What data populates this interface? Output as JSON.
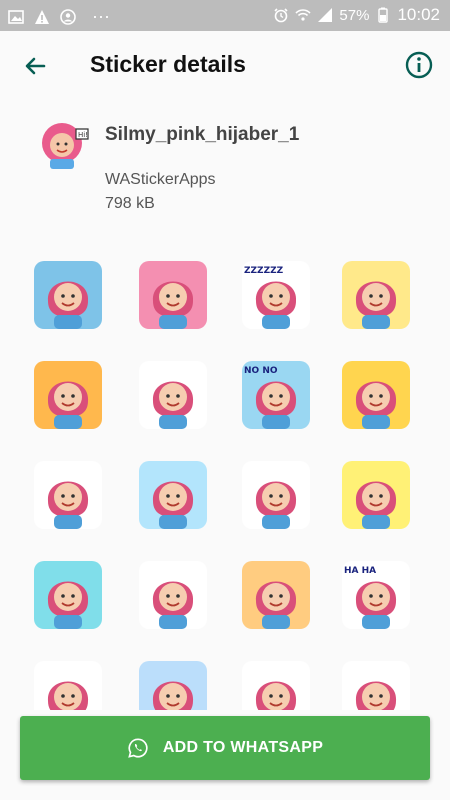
{
  "status_bar": {
    "battery": "57%",
    "time": "10:02",
    "dots": "···"
  },
  "app_bar": {
    "title": "Sticker details"
  },
  "pack": {
    "name": "Silmy_pink_hijaber_1",
    "publisher": "WAStickerApps",
    "size": "798 kB"
  },
  "stickers": [
    {
      "bg": "#7ec3e8",
      "text": ""
    },
    {
      "bg": "#f48fb1",
      "text": ""
    },
    {
      "bg": "#ffffff",
      "text": "ZZZZZZ"
    },
    {
      "bg": "#ffe98a",
      "text": ""
    },
    {
      "bg": "#ffb84d",
      "text": ""
    },
    {
      "bg": "#ffffff",
      "text": ""
    },
    {
      "bg": "#9ad7f2",
      "text": "NO NO"
    },
    {
      "bg": "#ffd54f",
      "text": ""
    },
    {
      "bg": "#ffffff",
      "text": ""
    },
    {
      "bg": "#b3e5fc",
      "text": ""
    },
    {
      "bg": "#ffffff",
      "text": ""
    },
    {
      "bg": "#fff176",
      "text": ""
    },
    {
      "bg": "#80deea",
      "text": ""
    },
    {
      "bg": "#ffffff",
      "text": ""
    },
    {
      "bg": "#ffcc80",
      "text": ""
    },
    {
      "bg": "#ffffff",
      "text": "HA HA"
    },
    {
      "bg": "#ffffff",
      "text": ""
    },
    {
      "bg": "#bbdefb",
      "text": ""
    },
    {
      "bg": "#ffffff",
      "text": ""
    },
    {
      "bg": "#ffffff",
      "text": ""
    }
  ],
  "button": {
    "label": "ADD TO WHATSAPP"
  },
  "colors": {
    "accent": "#075e54",
    "primary_button": "#4caf50"
  },
  "icons": [
    "back-arrow-icon",
    "info-icon",
    "whatsapp-icon"
  ]
}
